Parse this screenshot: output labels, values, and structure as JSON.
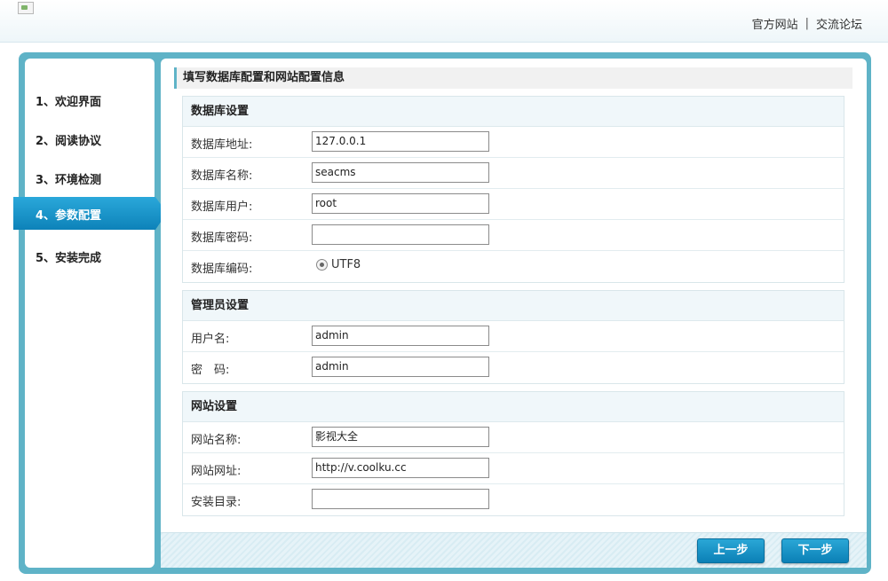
{
  "header": {
    "links": [
      "官方网站",
      "交流论坛"
    ],
    "separator": "|"
  },
  "steps": [
    {
      "label": "1、欢迎界面",
      "active": false
    },
    {
      "label": "2、阅读协议",
      "active": false
    },
    {
      "label": "3、环境检测",
      "active": false
    },
    {
      "label": "4、参数配置",
      "active": true
    },
    {
      "label": "5、安装完成",
      "active": false
    }
  ],
  "main": {
    "title": "填写数据库配置和网站配置信息",
    "database": {
      "heading": "数据库设置",
      "host_label": "数据库地址:",
      "host_value": "127.0.0.1",
      "name_label": "数据库名称:",
      "name_value": "seacms",
      "user_label": "数据库用户:",
      "user_value": "root",
      "password_label": "数据库密码:",
      "password_value": "",
      "charset_label": "数据库编码:",
      "charset_option": "UTF8"
    },
    "admin": {
      "heading": "管理员设置",
      "username_label": "用户名:",
      "username_value": "admin",
      "password_label": "密　码:",
      "password_value": "admin"
    },
    "site": {
      "heading": "网站设置",
      "name_label": "网站名称:",
      "name_value": "影视大全",
      "url_label": "网站网址:",
      "url_value": "http://v.coolku.cc",
      "dir_label": "安装目录:",
      "dir_value": ""
    }
  },
  "buttons": {
    "prev": "上一步",
    "next": "下一步"
  },
  "colors": {
    "accent": "#5fb3c7",
    "button": "#1194c8",
    "active_step": "#1a8fc4"
  }
}
